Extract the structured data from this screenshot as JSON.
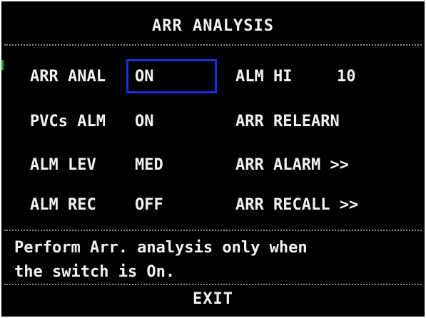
{
  "title": "ARR ANALYSIS",
  "rows": [
    {
      "left_label": "ARR ANAL",
      "left_value": "ON",
      "right_label": "ALM HI",
      "right_value": "10"
    },
    {
      "left_label": "PVCs ALM",
      "left_value": "ON",
      "right_label": "ARR RELEARN",
      "right_value": ""
    },
    {
      "left_label": "ALM LEV",
      "left_value": "MED",
      "right_label": "ARR ALARM >>",
      "right_value": ""
    },
    {
      "left_label": "ALM REC",
      "left_value": "OFF",
      "right_label": "ARR RECALL >>",
      "right_value": ""
    }
  ],
  "help_text": {
    "line1": "Perform Arr. analysis only when",
    "line2": "the switch is On."
  },
  "exit_label": "EXIT",
  "colors": {
    "background": "#000000",
    "text": "#f2f2f2",
    "selection_border": "#1133dd",
    "border": "#ffffff"
  }
}
